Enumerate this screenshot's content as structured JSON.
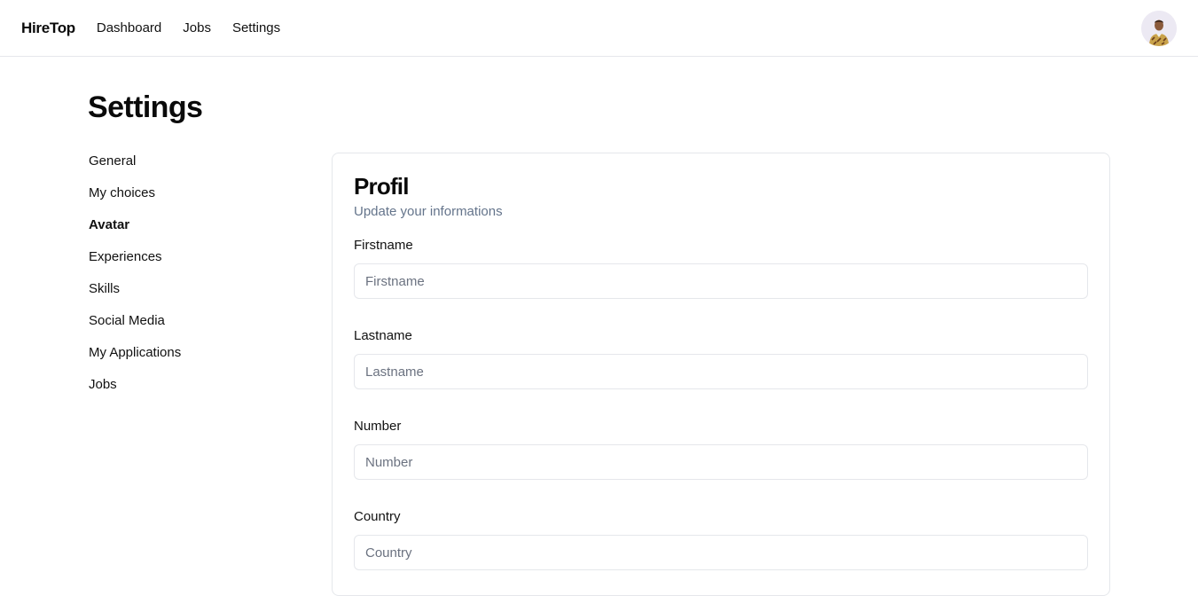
{
  "header": {
    "brand": "HireTop",
    "nav": [
      {
        "label": "Dashboard"
      },
      {
        "label": "Jobs"
      },
      {
        "label": "Settings"
      }
    ]
  },
  "page": {
    "title": "Settings"
  },
  "sidebar": {
    "items": [
      {
        "label": "General"
      },
      {
        "label": "My choices"
      },
      {
        "label": "Avatar",
        "active": true
      },
      {
        "label": "Experiences"
      },
      {
        "label": "Skills"
      },
      {
        "label": "Social Media"
      },
      {
        "label": "My Applications"
      },
      {
        "label": "Jobs"
      }
    ]
  },
  "profile": {
    "title": "Profil",
    "subtitle": "Update your informations",
    "fields": [
      {
        "label": "Firstname",
        "placeholder": "Firstname",
        "value": ""
      },
      {
        "label": "Lastname",
        "placeholder": "Lastname",
        "value": ""
      },
      {
        "label": "Number",
        "placeholder": "Number",
        "value": ""
      },
      {
        "label": "Country",
        "placeholder": "Country",
        "value": ""
      }
    ]
  },
  "colors": {
    "border": "#e5e7eb",
    "muted_text": "#64748b",
    "avatar_bg": "#ece9f3"
  },
  "icons": {
    "avatar": "user-avatar-photo"
  }
}
